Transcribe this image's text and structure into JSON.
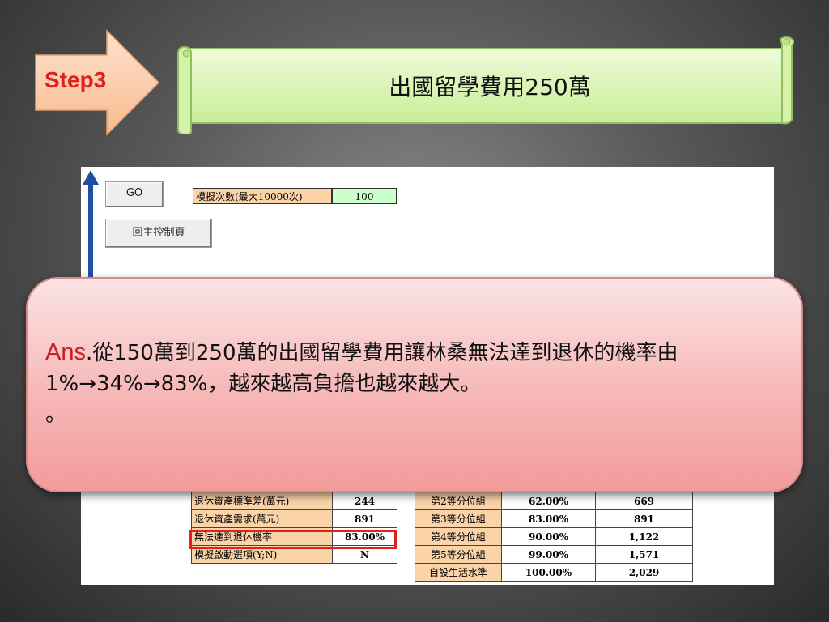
{
  "step": {
    "label": "Step3"
  },
  "banner": {
    "title": "出國留學費用250萬"
  },
  "sheet": {
    "go_button": "GO",
    "home_button": "回主控制頁",
    "sim_label": "模擬次數(最大10000次)",
    "sim_value": "100",
    "left_rows": [
      {
        "label": "退休資產標準差(萬元)",
        "value": "244"
      },
      {
        "label": "退休資產需求(萬元)",
        "value": "891"
      },
      {
        "label": "無法達到退休機率",
        "value": "83.00%"
      },
      {
        "label": "模擬啟動選項(Y;N)",
        "value": "N"
      }
    ],
    "right_rows": [
      {
        "group": "第2等分位組",
        "pct": "62.00%",
        "amount": "669"
      },
      {
        "group": "第3等分位組",
        "pct": "83.00%",
        "amount": "891"
      },
      {
        "group": "第4等分位組",
        "pct": "90.00%",
        "amount": "1,122"
      },
      {
        "group": "第5等分位組",
        "pct": "99.00%",
        "amount": "1,571"
      },
      {
        "group": "自設生活水準",
        "pct": "100.00%",
        "amount": "2,029"
      }
    ]
  },
  "callout": {
    "prefix": "Ans",
    "body": ".從150萬到250萬的出國留學費用讓林桑無法達到退休的機率由1%→34%→83%，越來越高負擔也越來越大。",
    "tail": "。"
  },
  "colors": {
    "accent_red": "#e0201c",
    "banner_green": "#d6f5b0",
    "callout_pink": "#f6b7b7"
  }
}
